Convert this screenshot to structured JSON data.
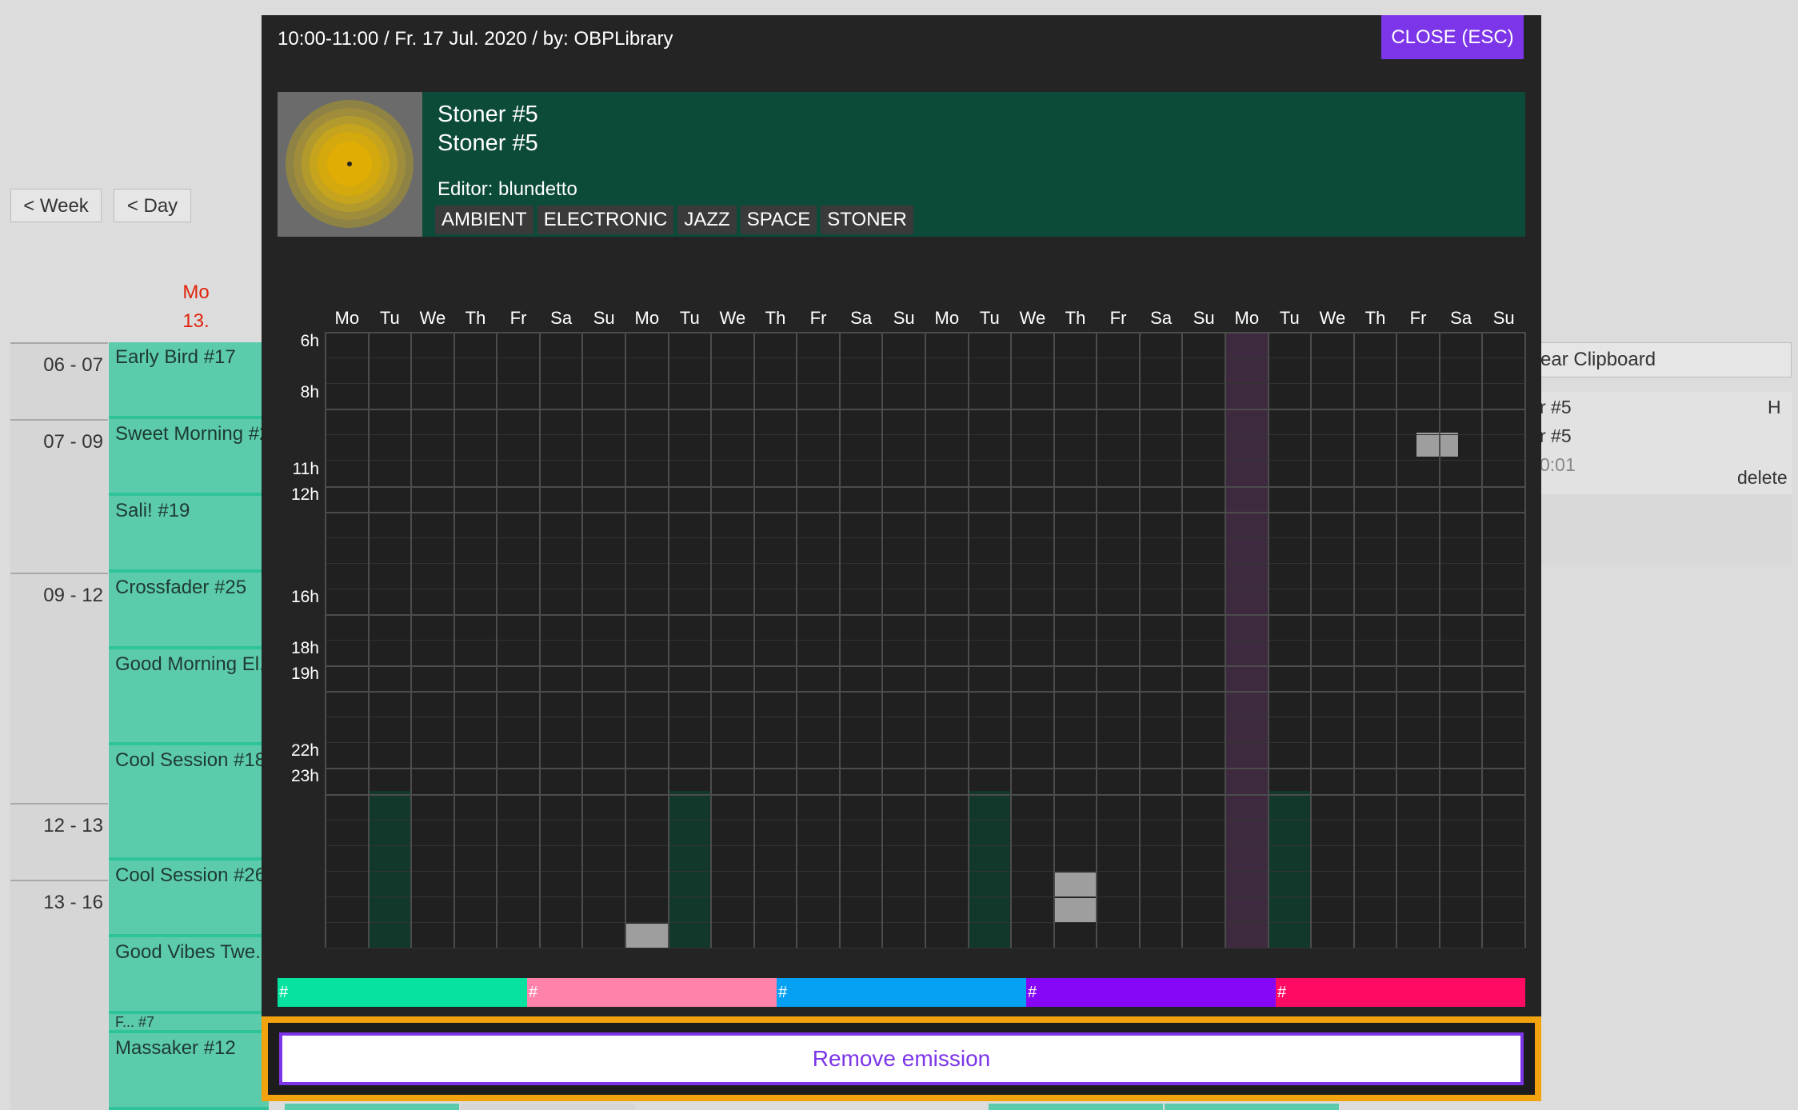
{
  "nav": {
    "week_label": "< Week",
    "day_label": "< Day"
  },
  "day_header": {
    "weekday": "Mo",
    "date": "13."
  },
  "time_blocks": [
    {
      "label": "06 - 07"
    },
    {
      "label": "07 - 09"
    },
    {
      "label": "09 - 12"
    },
    {
      "label": "12 - 13"
    },
    {
      "label": "13 - 16"
    }
  ],
  "shows": [
    {
      "label": "Early Bird #17"
    },
    {
      "label": "Sweet Morning #2"
    },
    {
      "label": "Sali! #19"
    },
    {
      "label": "Crossfader #25"
    },
    {
      "label": "Good Morning El..."
    },
    {
      "label": "Cool Session #18"
    },
    {
      "label": "Cool Session #26"
    },
    {
      "label": "Good Vibes Twe..."
    },
    {
      "label": "F...      #7"
    },
    {
      "label": "Massaker #12"
    }
  ],
  "clipboard": {
    "button_label": "ear Clipboard",
    "line1": "r #5",
    "line1_right": "H",
    "line2": "r #5",
    "line3": "0:01",
    "delete_label": "delete"
  },
  "modal": {
    "title": "10:00-11:00 / Fr. 17 Jul. 2020 / by: OBPLibrary",
    "close_label": "CLOSE (ESC)",
    "show": {
      "title": "Stoner #5",
      "subtitle": "Stoner #5",
      "editor": "Editor: blundetto",
      "tags": [
        "AMBIENT",
        "ELECTRONIC",
        "JAZZ",
        "SPACE",
        "STONER"
      ]
    },
    "grid": {
      "days": [
        "Mo",
        "Tu",
        "We",
        "Th",
        "Fr",
        "Sa",
        "Su",
        "Mo",
        "Tu",
        "We",
        "Th",
        "Fr",
        "Sa",
        "Su",
        "Mo",
        "Tu",
        "We",
        "Th",
        "Fr",
        "Sa",
        "Su",
        "Mo",
        "Tu",
        "We",
        "Th",
        "Fr",
        "Sa",
        "Su"
      ],
      "hours": [
        "6h",
        "8h",
        "11h",
        "12h",
        "16h",
        "18h",
        "19h",
        "22h",
        "23h"
      ],
      "current_day_index": 21
    },
    "color_bar": [
      {
        "label": "#",
        "color": "#06e3a0"
      },
      {
        "label": "#",
        "color": "#ff82ab"
      },
      {
        "label": "#",
        "color": "#06a1f3"
      },
      {
        "label": "#",
        "color": "#8607f8"
      },
      {
        "label": "#",
        "color": "#ff0b64"
      }
    ],
    "remove_label": "Remove emission"
  },
  "colors": {
    "accent": "#7c35e8",
    "highlight_frame": "#f1a20c",
    "show_card": "#0c4a3a",
    "show_block": "#5ccbac",
    "current_day": "#3d2a3f",
    "scheduled_slot": "#12382b",
    "existing_slot": "#9e9e9e"
  }
}
